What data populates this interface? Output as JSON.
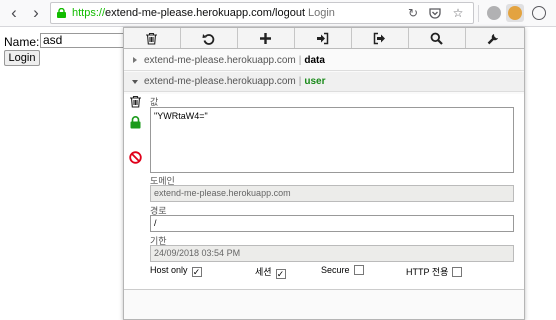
{
  "browser": {
    "url_scheme": "https://",
    "url_host": "extend-me-please.herokuapp.com",
    "url_path": "/logout",
    "page_title": "Login",
    "icons": [
      "back-icon",
      "forward-icon",
      "lock-icon",
      "reload-icon",
      "pocket-icon",
      "star-icon",
      "globe-icon",
      "cookie-icon",
      "menu-icon"
    ]
  },
  "page": {
    "name_label": "Name:",
    "name_value": "asd",
    "login_label": "Login"
  },
  "popup": {
    "toolbar_icons": [
      "trash-icon",
      "undo-icon",
      "add-icon",
      "import-icon",
      "export-icon",
      "search-icon",
      "wrench-icon"
    ],
    "cookies": [
      {
        "domain": "extend-me-please.herokuapp.com",
        "separator": "|",
        "name": "data"
      },
      {
        "domain": "extend-me-please.herokuapp.com",
        "separator": "|",
        "name": "user"
      }
    ],
    "detail": {
      "value_label": "값",
      "value": "\"YWRtaW4=\"",
      "domain_label": "도메인",
      "domain_value": "extend-me-please.herokuapp.com",
      "path_label": "경로",
      "path_value": "/",
      "expiry_label": "기한",
      "expiry_value": "24/09/2018 03:54 PM",
      "options": [
        {
          "label": "Host only",
          "checked": true,
          "check_mark": "✓"
        },
        {
          "label": "세션",
          "checked": true,
          "check_mark": "✓"
        },
        {
          "label": "Secure",
          "checked": false,
          "check_mark": ""
        },
        {
          "label": "HTTP 전용",
          "checked": false,
          "check_mark": ""
        }
      ]
    },
    "colors": {
      "cookie_name_active": "#1a8a1a",
      "lock_green": "#12bc00",
      "block_red": "#e0001a"
    }
  }
}
